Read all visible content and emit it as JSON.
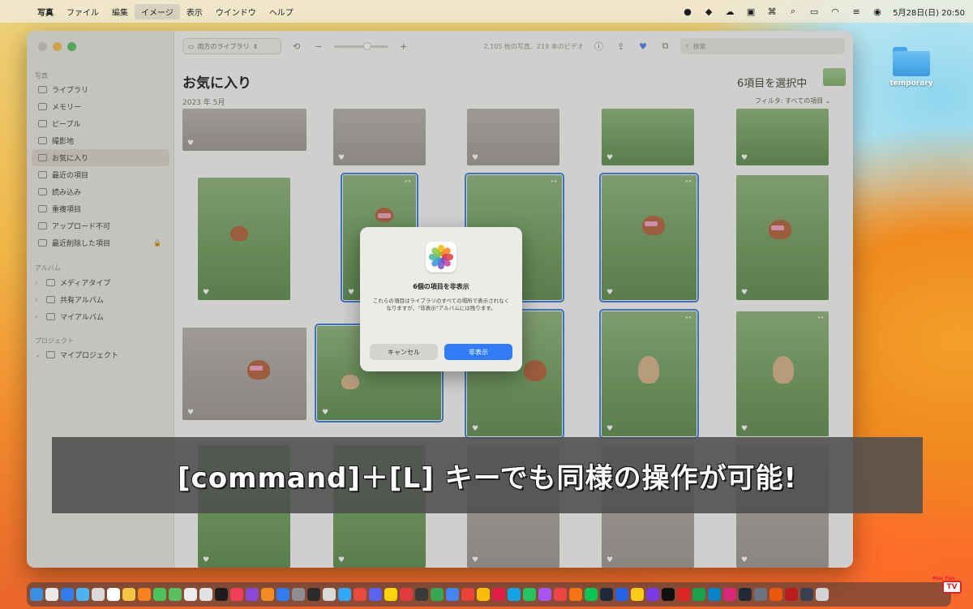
{
  "menubar": {
    "items": [
      "写真",
      "ファイル",
      "編集",
      "イメージ",
      "表示",
      "ウインドウ",
      "ヘルプ"
    ],
    "active_index": 3,
    "clock": "5月28日(日)  20:50"
  },
  "desktop": {
    "folder_label": "temporary"
  },
  "toolbar": {
    "library_select": "両方のライブラリ",
    "counts": "2,105 枚の写真、219 本のビデオ",
    "search_placeholder": "検索"
  },
  "sidebar": {
    "section_photos": "写真",
    "photos_items": [
      "ライブラリ",
      "メモリー",
      "ピープル",
      "撮影地",
      "お気に入り",
      "最近の項目",
      "読み込み",
      "重複項目",
      "アップロード不可",
      "最近削除した項目"
    ],
    "selected_index": 4,
    "section_albums": "アルバム",
    "album_items": [
      "メディアタイプ",
      "共有アルバム",
      "マイアルバム"
    ],
    "section_projects": "プロジェクト",
    "project_items": [
      "マイプロジェクト"
    ]
  },
  "content": {
    "title": "お気に入り",
    "month": "2023 年 5月",
    "selection_count": "6項目を選択中",
    "filter": "フィルタ: すべての項目"
  },
  "dialog": {
    "title": "6個の項目を非表示",
    "message": "これらの項目はライブラリのすべての場所で表示されなくなりますが、\"非表示\"アルバムには残ります。",
    "cancel_label": "キャンセル",
    "confirm_label": "非表示"
  },
  "caption": {
    "text": "[command]＋[L] キーでも同様の操作が可能!"
  },
  "colors": {
    "accent_blue": "#2f7cf6",
    "selection_outline": "#3b7fe6",
    "caption_bg": "#4e4e4e"
  },
  "corner_logo": {
    "brand": "Mac Fan",
    "tv": "TV"
  }
}
